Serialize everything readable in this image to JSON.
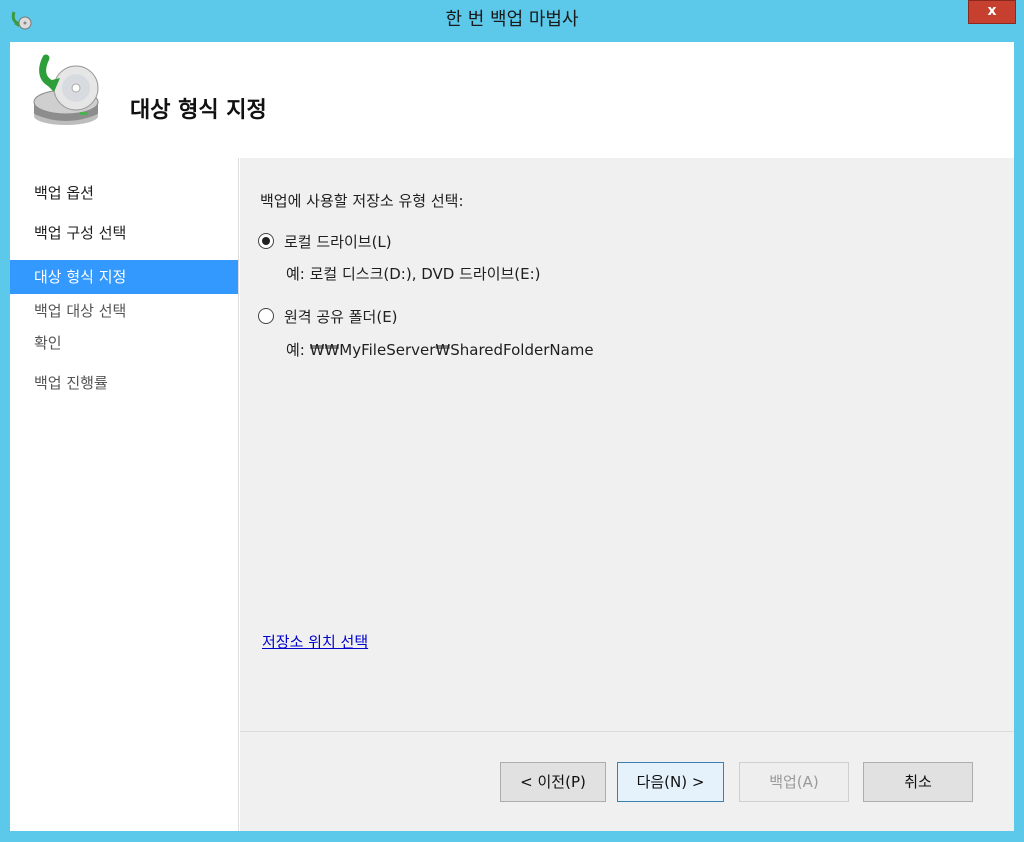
{
  "window": {
    "title": "한 번 백업 마법사",
    "close_label": "x"
  },
  "header": {
    "title": "대상 형식 지정"
  },
  "sidebar": {
    "items": [
      {
        "label": "백업 옵션",
        "state": "done"
      },
      {
        "label": "백업 구성 선택",
        "state": "done"
      },
      {
        "label": "대상 형식 지정",
        "state": "active"
      },
      {
        "label": "백업 대상 선택",
        "state": "pending"
      },
      {
        "label": "확인",
        "state": "pending"
      },
      {
        "label": "백업 진행률",
        "state": "pending"
      }
    ]
  },
  "main": {
    "prompt": "백업에 사용할 저장소 유형 선택:",
    "options": [
      {
        "label": "로컬 드라이브(L)",
        "example": "예: 로컬 디스크(D:), DVD 드라이브(E:)",
        "selected": true
      },
      {
        "label": "원격 공유 폴더(E)",
        "example": "예: ₩₩MyFileServer₩SharedFolderName",
        "selected": false
      }
    ],
    "help_link": "저장소 위치 선택"
  },
  "footer": {
    "prev_label": "< 이전(P)",
    "next_label": "다음(N) >",
    "backup_label": "백업(A)",
    "cancel_label": "취소"
  },
  "colors": {
    "frame": "#5cc8ea",
    "active_item": "#3399ff",
    "link": "#0000cc",
    "close": "#c7402f"
  },
  "icons": {
    "app": "backup-wizard-icon",
    "header": "drive-backup-arrow-icon"
  }
}
